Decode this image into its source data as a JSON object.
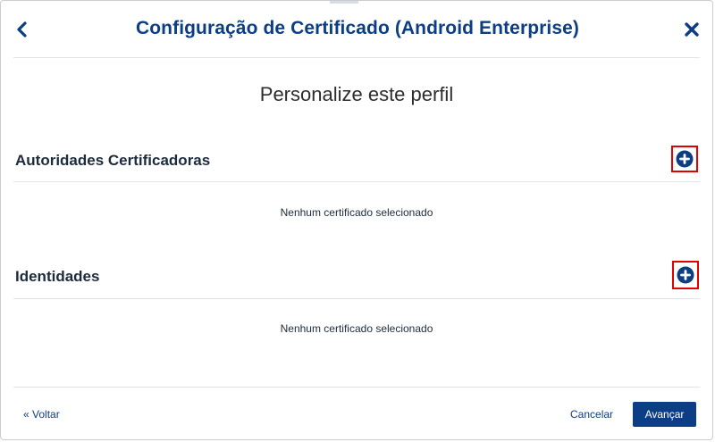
{
  "header": {
    "title": "Configuração de Certificado (Android Enterprise)",
    "back_icon": "chevron-left-icon",
    "close_icon": "close-icon"
  },
  "main": {
    "subtitle": "Personalize este perfil",
    "sections": [
      {
        "title": "Autoridades Certificadoras",
        "empty_text": "Nenhum certificado selecionado",
        "add_icon": "plus-circle-icon"
      },
      {
        "title": "Identidades",
        "empty_text": "Nenhum certificado selecionado",
        "add_icon": "plus-circle-icon"
      }
    ]
  },
  "footer": {
    "back_label": "« Voltar",
    "cancel_label": "Cancelar",
    "next_label": "Avançar"
  },
  "colors": {
    "primary": "#0c3e85",
    "highlight_border": "#e00000",
    "text_dark": "#1c2b3d",
    "divider": "#e2e5e8"
  }
}
